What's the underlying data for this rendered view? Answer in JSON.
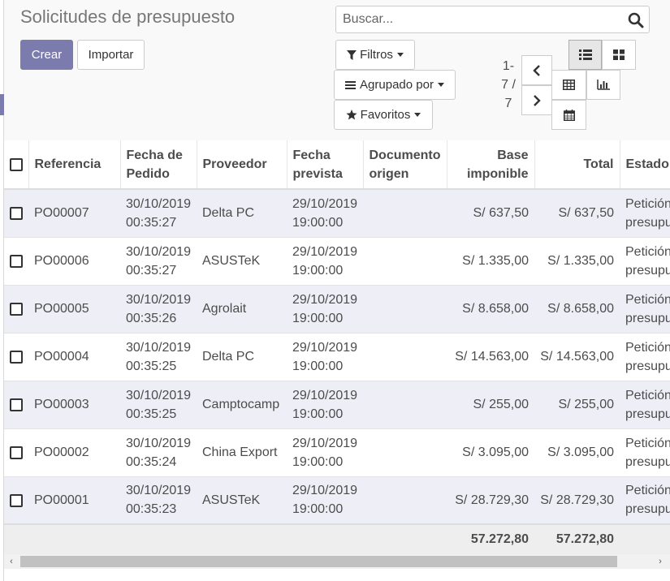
{
  "page": {
    "title": "Solicitudes de presupuesto",
    "accent_color": "#7c7bad",
    "row_highlight_color": "#eeeef7"
  },
  "toolbar": {
    "create_label": "Crear",
    "import_label": "Importar"
  },
  "search": {
    "placeholder": "Buscar..."
  },
  "filters": {
    "filters_label": "Filtros",
    "group_by_label": "Agrupado por",
    "favorites_label": "Favoritos"
  },
  "pager": {
    "line1": "1-",
    "line2": "7 /",
    "line3": "7"
  },
  "views": [
    "list-view",
    "kanban-view",
    "pivot-view",
    "graph-view",
    "calendar-view"
  ],
  "table": {
    "columns": [
      {
        "line1": "Referencia",
        "line2": ""
      },
      {
        "line1": "Fecha de",
        "line2": "Pedido"
      },
      {
        "line1": "Proveedor",
        "line2": ""
      },
      {
        "line1": "Fecha",
        "line2": "prevista"
      },
      {
        "line1": "Documento",
        "line2": "origen"
      },
      {
        "line1": "Base",
        "line2": "imponible"
      },
      {
        "line1": "Total",
        "line2": ""
      },
      {
        "line1": "Estado",
        "line2": ""
      }
    ],
    "rows": [
      {
        "ref": "PO00007",
        "order_date": "30/10/2019",
        "order_time": "00:35:27",
        "vendor": "Delta PC",
        "planned_date": "29/10/2019",
        "planned_time": "19:00:00",
        "source": "",
        "untaxed": "S/ 637,50",
        "total": "S/ 637,50",
        "status1": "Petición de",
        "status2": "presupuesto"
      },
      {
        "ref": "PO00006",
        "order_date": "30/10/2019",
        "order_time": "00:35:27",
        "vendor": "ASUSTeK",
        "planned_date": "29/10/2019",
        "planned_time": "19:00:00",
        "source": "",
        "untaxed": "S/ 1.335,00",
        "total": "S/ 1.335,00",
        "status1": "Petición de",
        "status2": "presupuesto"
      },
      {
        "ref": "PO00005",
        "order_date": "30/10/2019",
        "order_time": "00:35:26",
        "vendor": "Agrolait",
        "planned_date": "29/10/2019",
        "planned_time": "19:00:00",
        "source": "",
        "untaxed": "S/ 8.658,00",
        "total": "S/ 8.658,00",
        "status1": "Petición de",
        "status2": "presupuesto"
      },
      {
        "ref": "PO00004",
        "order_date": "30/10/2019",
        "order_time": "00:35:25",
        "vendor": "Delta PC",
        "planned_date": "29/10/2019",
        "planned_time": "19:00:00",
        "source": "",
        "untaxed": "S/ 14.563,00",
        "total": "S/ 14.563,00",
        "status1": "Petición de",
        "status2": "presupuesto"
      },
      {
        "ref": "PO00003",
        "order_date": "30/10/2019",
        "order_time": "00:35:25",
        "vendor": "Camptocamp",
        "planned_date": "29/10/2019",
        "planned_time": "19:00:00",
        "source": "",
        "untaxed": "S/ 255,00",
        "total": "S/ 255,00",
        "status1": "Petición de",
        "status2": "presupuesto"
      },
      {
        "ref": "PO00002",
        "order_date": "30/10/2019",
        "order_time": "00:35:24",
        "vendor": "China Export",
        "planned_date": "29/10/2019",
        "planned_time": "19:00:00",
        "source": "",
        "untaxed": "S/ 3.095,00",
        "total": "S/ 3.095,00",
        "status1": "Petición de",
        "status2": "presupuesto"
      },
      {
        "ref": "PO00001",
        "order_date": "30/10/2019",
        "order_time": "00:35:23",
        "vendor": "ASUSTeK",
        "planned_date": "29/10/2019",
        "planned_time": "19:00:00",
        "source": "",
        "untaxed": "S/ 28.729,30",
        "total": "S/ 28.729,30",
        "status1": "Petición de",
        "status2": "presupuesto"
      }
    ],
    "totals": {
      "untaxed": "57.272,80",
      "total": "57.272,80"
    }
  }
}
